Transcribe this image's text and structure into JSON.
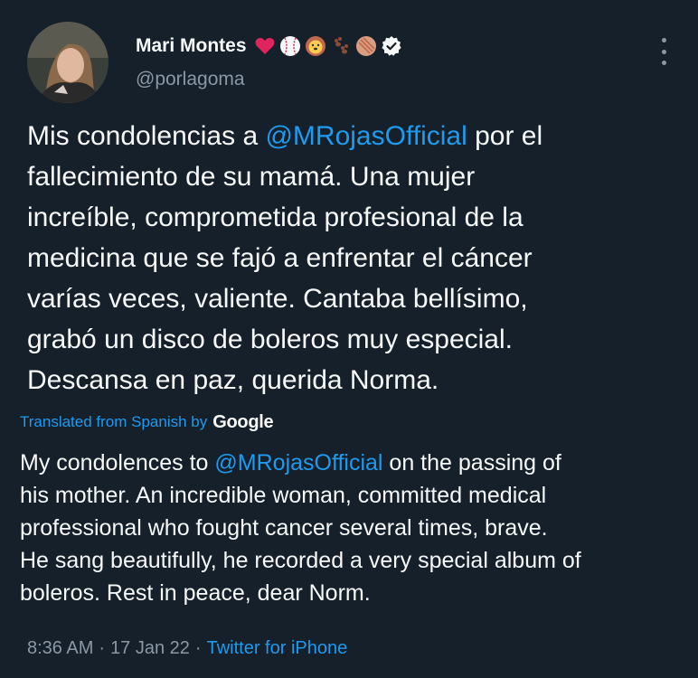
{
  "user": {
    "display_name": "Mari Montes",
    "handle": "@porlagoma",
    "verified": true,
    "name_emojis": [
      "heart-icon",
      "baseball-icon",
      "lion-icon",
      "paw-prints-icon",
      "cookie-icon"
    ]
  },
  "tweet": {
    "text_before_mention": "Mis condolencias a ",
    "mention": "@MRojasOfficial",
    "text_after_mention": " por el\nfallecimiento de su mamá. Una mujer\nincreíble, comprometida profesional de la\nmedicina que se fajó a enfrentar el cáncer\nvarías veces, valiente. Cantaba bellísimo,\ngrabó un disco de boleros muy especial.\nDescansa en paz, querida Norma."
  },
  "translation": {
    "label": "Translated from Spanish by",
    "provider": "Google",
    "text_before_mention": "My condolences to ",
    "mention": "@MRojasOfficial",
    "text_after_mention": " on the passing of\nhis mother. An incredible woman, committed medical\nprofessional who fought cancer several times, brave.\nHe sang beautifully, he recorded a very special album of\nboleros. Rest in peace, dear Norm."
  },
  "meta": {
    "time": "8:36 AM",
    "sep1": "·",
    "date": "17 Jan 22",
    "sep2": "·",
    "source": "Twitter for iPhone"
  },
  "colors": {
    "background": "#15202b",
    "link": "#1d9bf0",
    "secondary": "#8b98a5",
    "text": "#f7f9f9"
  }
}
